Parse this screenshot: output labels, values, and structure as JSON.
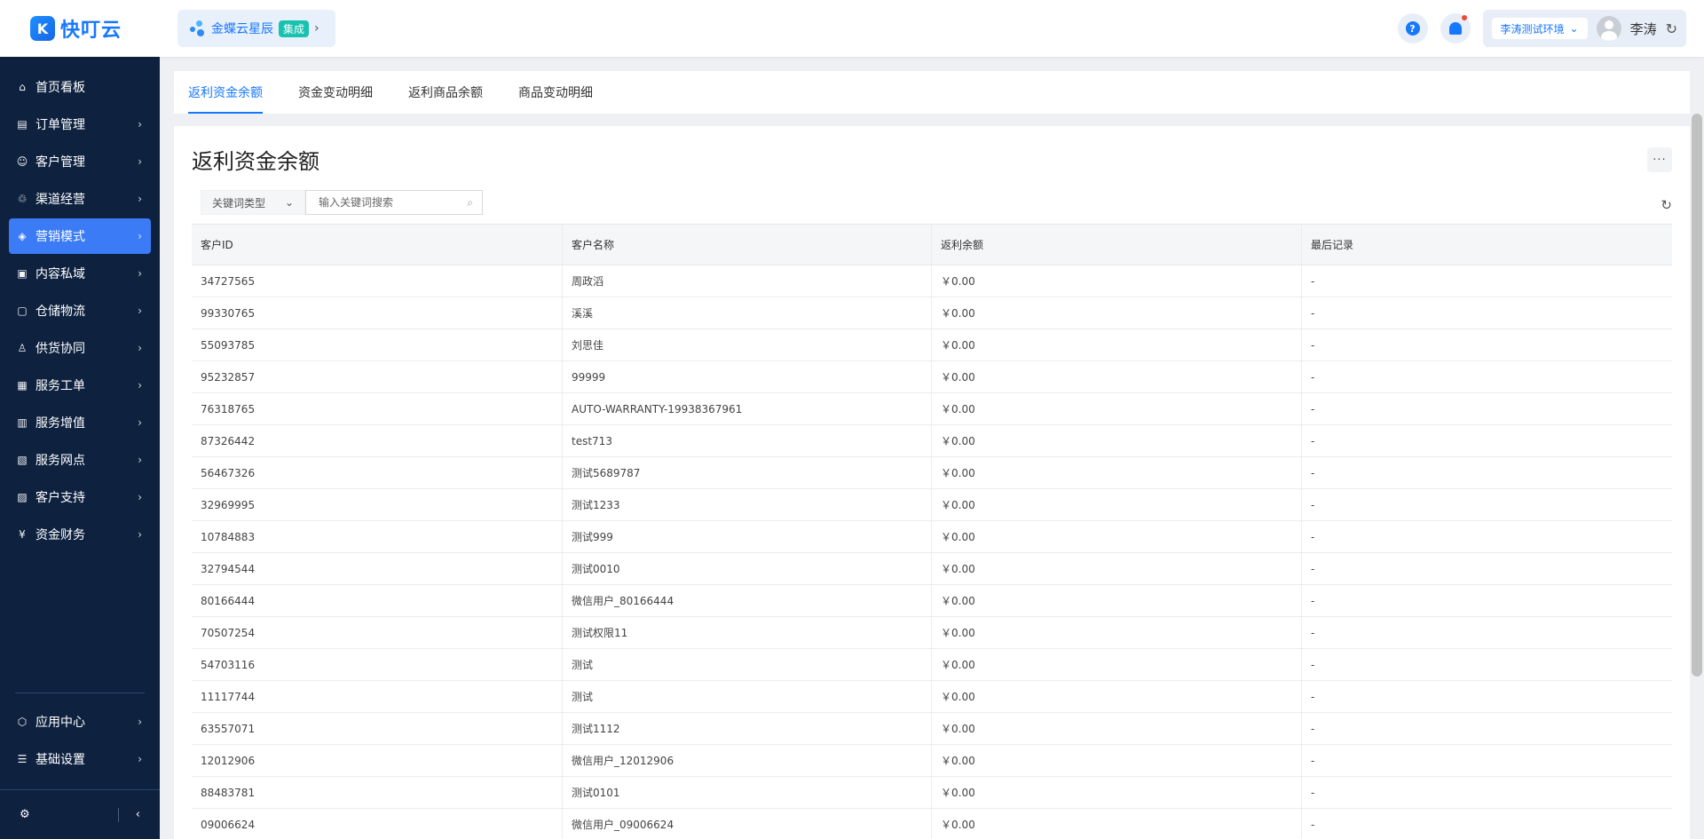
{
  "brand": {
    "logo_glyph": "K",
    "name": "快叮云"
  },
  "app_switch": {
    "name": "金蝶云星辰",
    "tag": "集成"
  },
  "header": {
    "help_glyph": "?",
    "env": "李涛测试环境",
    "user_name": "李涛"
  },
  "sidebar": {
    "items": [
      {
        "label": "首页看板",
        "icon": "home-icon",
        "glyph": "⌂",
        "has_arrow": false
      },
      {
        "label": "订单管理",
        "icon": "order-icon",
        "glyph": "▤",
        "has_arrow": true
      },
      {
        "label": "客户管理",
        "icon": "user-icon",
        "glyph": "☺",
        "has_arrow": true
      },
      {
        "label": "渠道经营",
        "icon": "channel-icon",
        "glyph": "♲",
        "has_arrow": true
      },
      {
        "label": "营销模式",
        "icon": "tag-icon",
        "glyph": "◈",
        "has_arrow": true,
        "active": true
      },
      {
        "label": "内容私域",
        "icon": "image-icon",
        "glyph": "▣",
        "has_arrow": true
      },
      {
        "label": "仓储物流",
        "icon": "box-icon",
        "glyph": "▢",
        "has_arrow": true
      },
      {
        "label": "供货协同",
        "icon": "supply-icon",
        "glyph": "♙",
        "has_arrow": true
      },
      {
        "label": "服务工单",
        "icon": "ticket-icon",
        "glyph": "▦",
        "has_arrow": true
      },
      {
        "label": "服务增值",
        "icon": "bag-icon",
        "glyph": "▥",
        "has_arrow": true
      },
      {
        "label": "服务网点",
        "icon": "store-icon",
        "glyph": "▧",
        "has_arrow": true
      },
      {
        "label": "客户支持",
        "icon": "support-icon",
        "glyph": "▨",
        "has_arrow": true
      },
      {
        "label": "资金财务",
        "icon": "yuan-icon",
        "glyph": "¥",
        "has_arrow": true
      }
    ],
    "bottom_items": [
      {
        "label": "应用中心",
        "icon": "cube-icon",
        "glyph": "⬡",
        "has_arrow": true
      },
      {
        "label": "基础设置",
        "icon": "settings-icon",
        "glyph": "☰",
        "has_arrow": true
      }
    ]
  },
  "tabs": [
    {
      "label": "返利资金余额",
      "active": true
    },
    {
      "label": "资金变动明细"
    },
    {
      "label": "返利商品余额"
    },
    {
      "label": "商品变动明细"
    }
  ],
  "page": {
    "title": "返利资金余额",
    "more_label": "···",
    "keyword_type": "关键词类型",
    "search_placeholder": "输入关键词搜索"
  },
  "table": {
    "columns": [
      "客户ID",
      "客户名称",
      "返利余额",
      "最后记录"
    ],
    "rows": [
      [
        "34727565",
        "周政滔",
        "￥0.00",
        "-"
      ],
      [
        "99330765",
        "溪溪",
        "￥0.00",
        "-"
      ],
      [
        "55093785",
        "刘思佳",
        "￥0.00",
        "-"
      ],
      [
        "95232857",
        "99999",
        "￥0.00",
        "-"
      ],
      [
        "76318765",
        "AUTO-WARRANTY-19938367961",
        "￥0.00",
        "-"
      ],
      [
        "87326442",
        "test713",
        "￥0.00",
        "-"
      ],
      [
        "56467326",
        "测试5689787",
        "￥0.00",
        "-"
      ],
      [
        "32969995",
        "测试1233",
        "￥0.00",
        "-"
      ],
      [
        "10784883",
        "测试999",
        "￥0.00",
        "-"
      ],
      [
        "32794544",
        "测试0010",
        "￥0.00",
        "-"
      ],
      [
        "80166444",
        "微信用户_80166444",
        "￥0.00",
        "-"
      ],
      [
        "70507254",
        "测试权限11",
        "￥0.00",
        "-"
      ],
      [
        "54703116",
        "测试",
        "￥0.00",
        "-"
      ],
      [
        "11117744",
        "测试",
        "￥0.00",
        "-"
      ],
      [
        "63557071",
        "测试1112",
        "￥0.00",
        "-"
      ],
      [
        "12012906",
        "微信用户_12012906",
        "￥0.00",
        "-"
      ],
      [
        "88483781",
        "测试0101",
        "￥0.00",
        "-"
      ],
      [
        "09006624",
        "微信用户_09006624",
        "￥0.00",
        "-"
      ]
    ]
  },
  "colors": {
    "accent": "#1677ff",
    "sidebar_bg": "#0e2240",
    "active_menu": "#3b7bf6"
  }
}
